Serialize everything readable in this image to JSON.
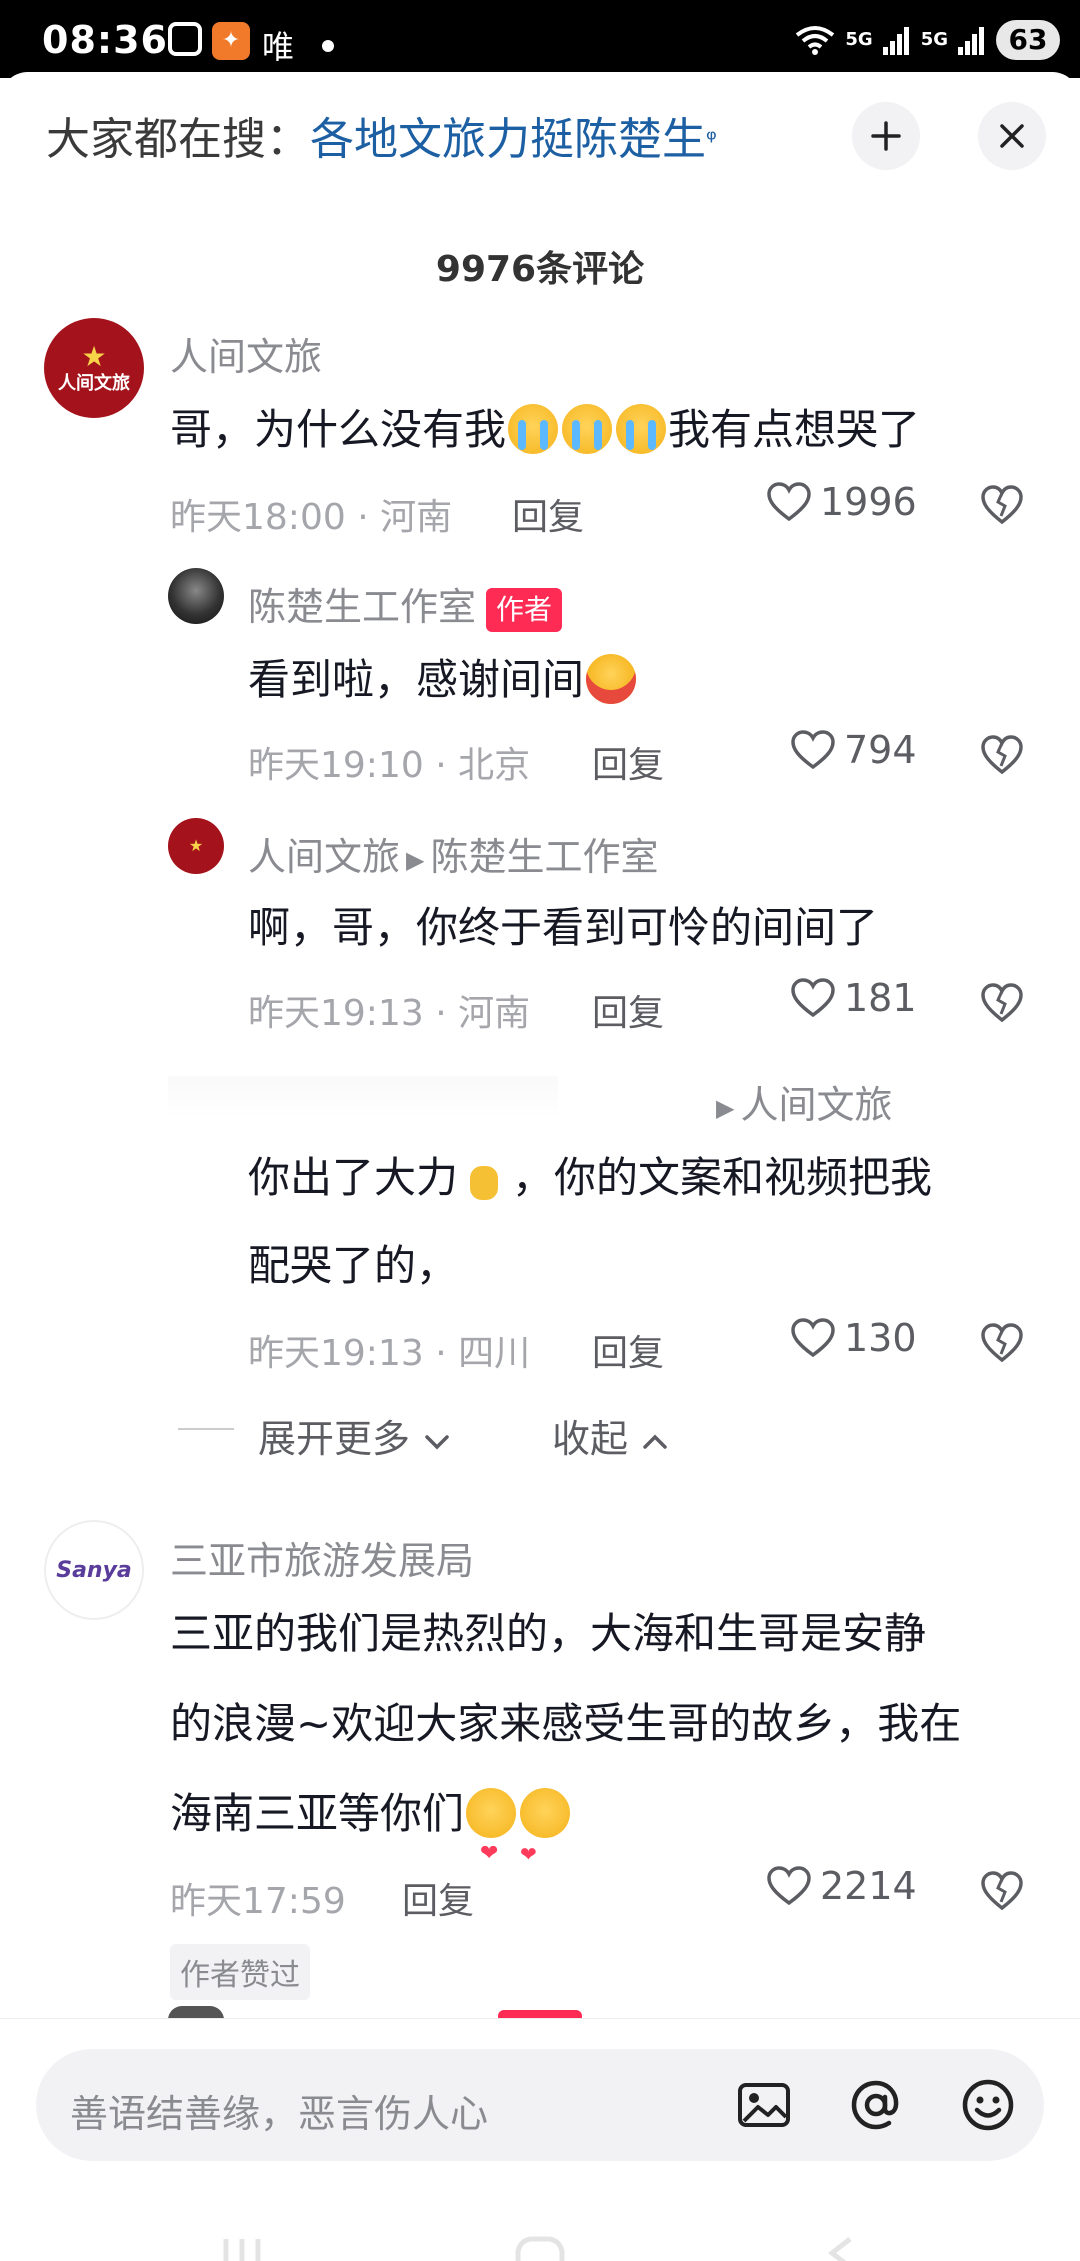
{
  "status": {
    "time": "08:36",
    "app_label": "唯",
    "signal_1": "5G",
    "signal_2": "5G",
    "battery": "63"
  },
  "header": {
    "search_label": "大家都在搜：",
    "search_keyword": "各地文旅力挺陈楚生",
    "comment_count": "9976条评论"
  },
  "comments": [
    {
      "author": "人间文旅",
      "avatar_text": "人间文旅",
      "body": "哥，为什么没有我",
      "body_after": "我有点想哭了",
      "time_loc": "昨天18:00 · 河南",
      "reply": "回复",
      "likes": "1996"
    },
    {
      "author": "陈楚生工作室",
      "author_tag": "作者",
      "body": "看到啦，感谢间间",
      "time_loc": "昨天19:10 · 北京",
      "reply": "回复",
      "likes": "794"
    },
    {
      "author": "人间文旅",
      "reply_to": "陈楚生工作室",
      "body": "啊，哥，你终于看到可怜的间间了",
      "time_loc": "昨天19:13 · 河南",
      "reply": "回复",
      "likes": "181"
    },
    {
      "author": "",
      "reply_to": "人间文旅",
      "body_line1_a": "你出了大力",
      "body_line1_b": "，你的文案和视频把我",
      "body_line2": "配哭了的，",
      "time_loc": "昨天19:13 · 四川",
      "reply": "回复",
      "likes": "130"
    },
    {
      "author": "三亚市旅游发展局",
      "avatar_text": "Sanya",
      "body_line1": "三亚的我们是热烈的，大海和生哥是安静",
      "body_line2": "的浪漫~欢迎大家来感受生哥的故乡，我在",
      "body_line3": "海南三亚等你们",
      "time_loc": "昨天17:59",
      "reply": "回复",
      "likes": "2214",
      "badge": "作者赞过"
    }
  ],
  "thread_controls": {
    "expand_more": "展开更多",
    "collapse": "收起"
  },
  "input": {
    "placeholder": "善语结善缘，恶言伤人心"
  },
  "colors": {
    "author_tag": "#fe2c55",
    "keyword": "#1d5fa3",
    "henan_avatar": "#a4121b"
  }
}
